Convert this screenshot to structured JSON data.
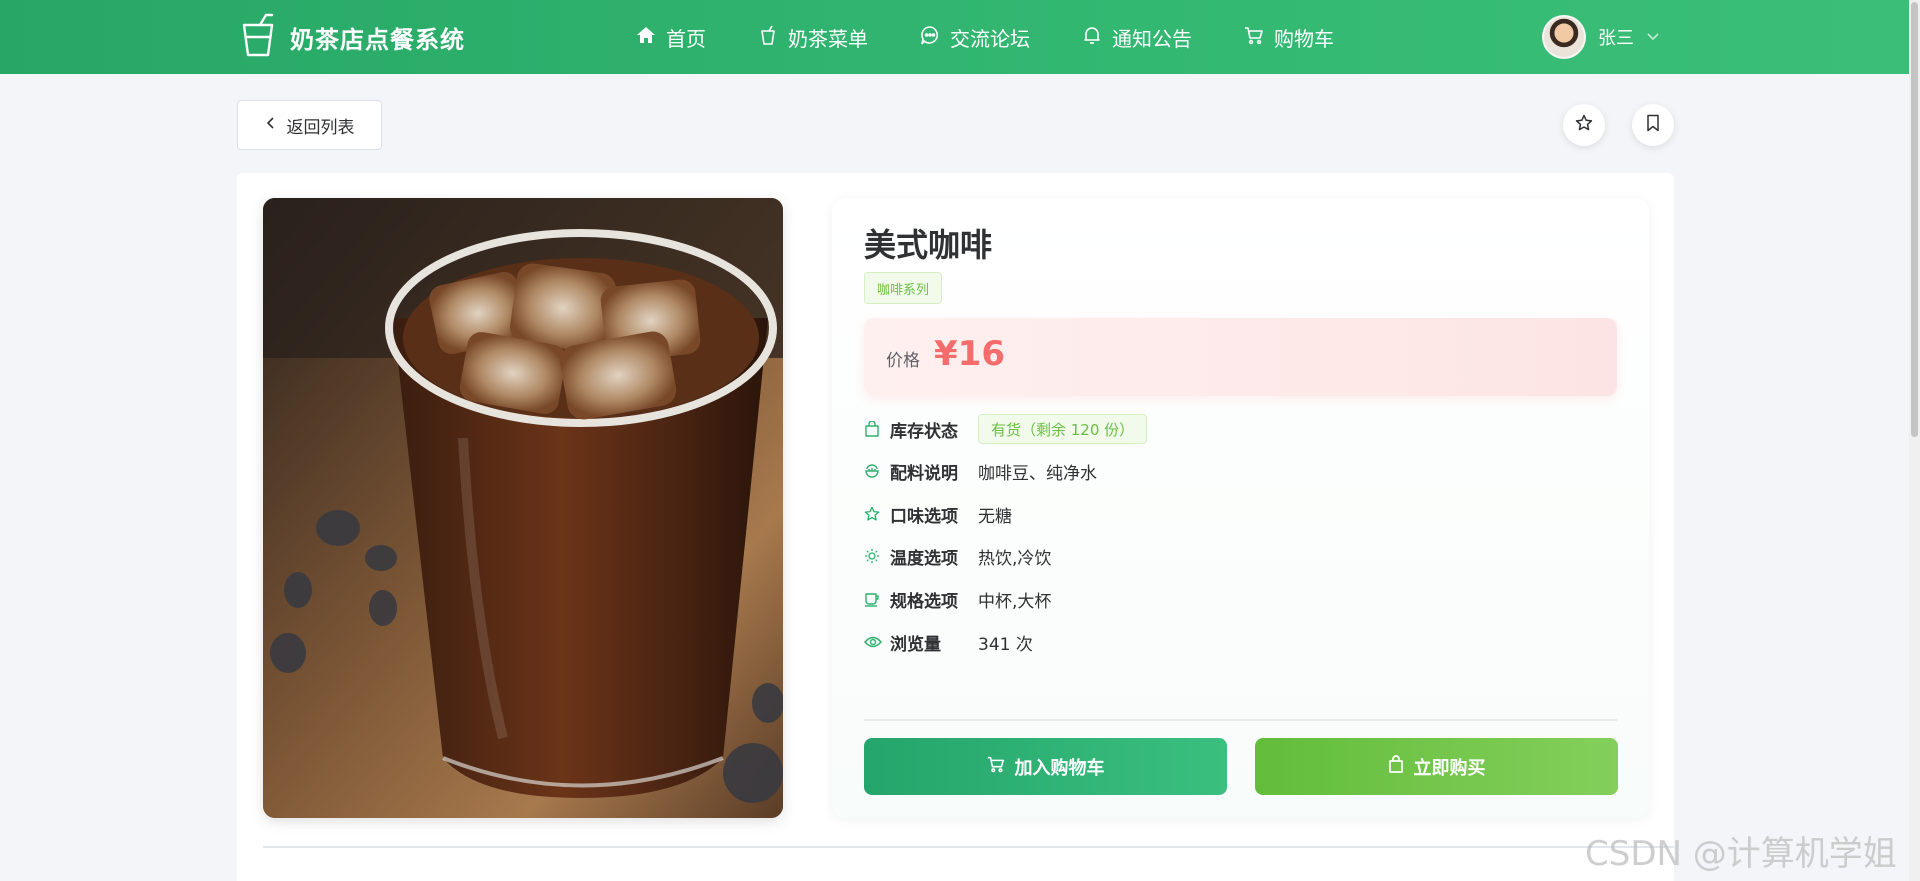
{
  "app": {
    "brand": "奶茶店点餐系统",
    "brand_icon": "cup-icon"
  },
  "nav": {
    "items": [
      {
        "label": "首页",
        "icon": "home-icon"
      },
      {
        "label": "奶茶菜单",
        "icon": "cup-icon"
      },
      {
        "label": "交流论坛",
        "icon": "chat-icon"
      },
      {
        "label": "通知公告",
        "icon": "bell-icon"
      },
      {
        "label": "购物车",
        "icon": "cart-icon"
      }
    ]
  },
  "user": {
    "name": "张三"
  },
  "toolbar": {
    "back_label": "返回列表"
  },
  "product": {
    "name": "美式咖啡",
    "category": "咖啡系列",
    "price_label": "价格",
    "price": "¥16",
    "details": [
      {
        "label": "库存状态",
        "value": "有货（剩余 120 份）",
        "icon": "bag-icon"
      },
      {
        "label": "配料说明",
        "value": "咖啡豆、纯净水",
        "icon": "ingredients-icon"
      },
      {
        "label": "口味选项",
        "value": "无糖",
        "icon": "star-icon"
      },
      {
        "label": "温度选项",
        "value": "热饮,冷饮",
        "icon": "sun-icon"
      },
      {
        "label": "规格选项",
        "value": "中杯,大杯",
        "icon": "mug-icon"
      },
      {
        "label": "浏览量",
        "value": "341 次",
        "icon": "eye-icon"
      }
    ]
  },
  "actions": {
    "add_cart": "加入购物车",
    "buy_now": "立即购买"
  },
  "watermark": "CSDN @计算机学姐",
  "colors": {
    "primary": "#2eb06d",
    "price": "#f56c6c",
    "tag": "#6cbf43"
  }
}
